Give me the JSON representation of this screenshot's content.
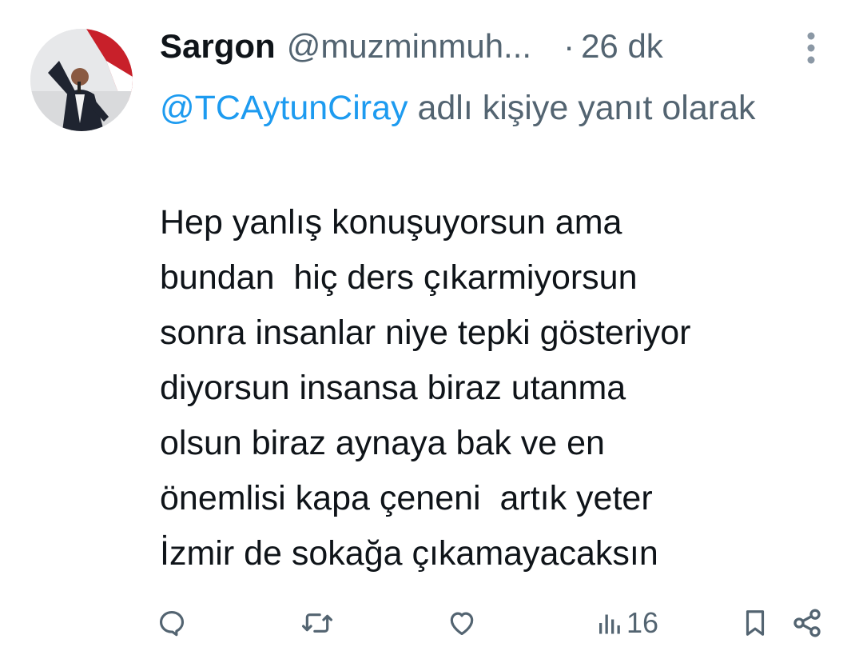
{
  "tweet": {
    "author_name": "Sargon",
    "author_handle": "@muzminmuh...",
    "separator": "·",
    "time": "26 dk",
    "reply_to_handle": "@TCAytunCiray",
    "reply_to_suffix": " adlı kişiye yanıt olarak",
    "body": "Hep yanlış konuşuyorsun ama\nbundan  hiç ders çıkarmiyorsun\nsonra insanlar niye tepki gösteriyor\ndiyorsun insansa biraz utanma\nolsun biraz aynaya bak ve en\nönemlisi kapa çeneni  artık yeter\nİzmir de sokağa çıkamayacaksın"
  },
  "actions": {
    "views_count": "16"
  },
  "icons": {
    "more": "more-vertical-icon",
    "reply": "reply-icon",
    "retweet": "retweet-icon",
    "like": "heart-icon",
    "views": "views-chart-icon",
    "bookmark": "bookmark-icon",
    "share": "share-icon"
  },
  "colors": {
    "text": "#0f1419",
    "secondary": "#536471",
    "link": "#1d9bf0",
    "background": "#ffffff"
  }
}
